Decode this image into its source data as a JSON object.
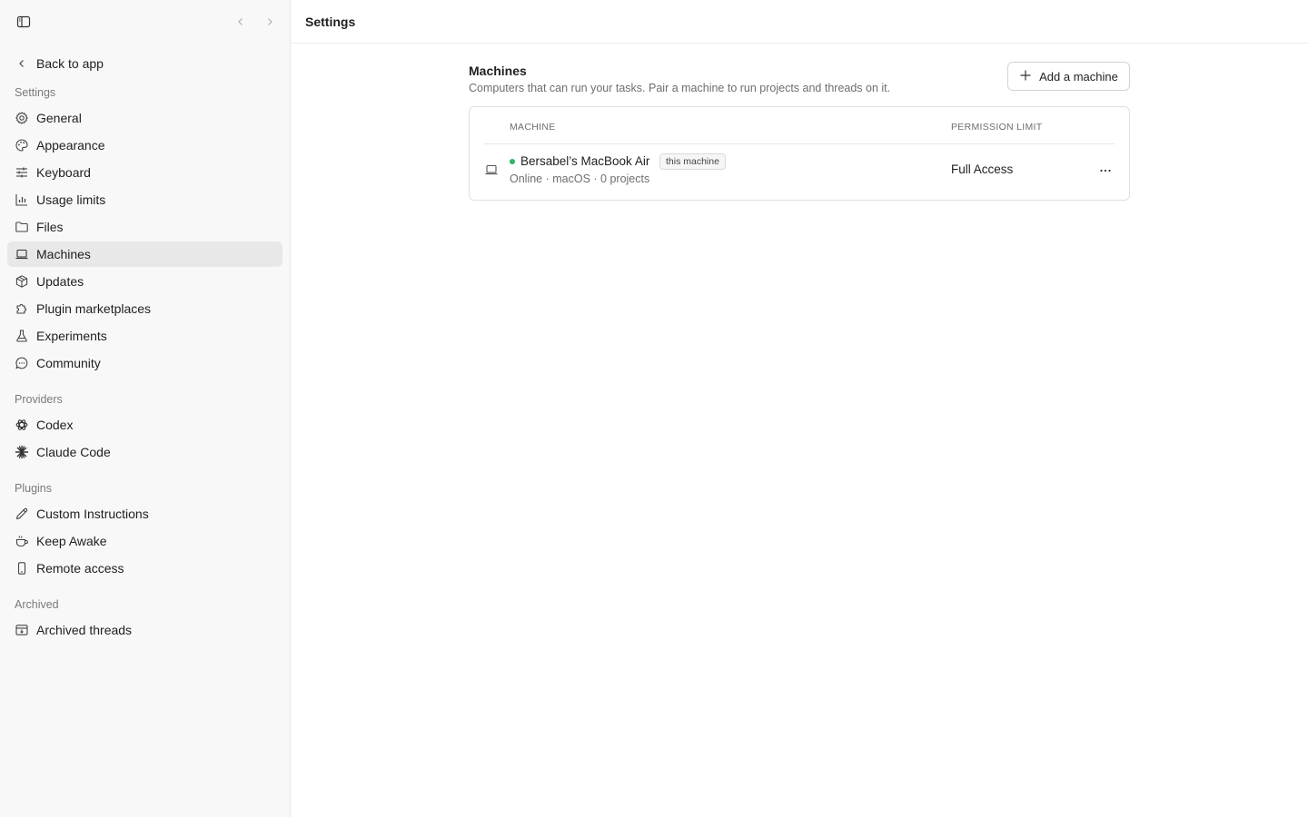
{
  "sidebar": {
    "back_label": "Back to app",
    "sections": {
      "settings": "Settings",
      "providers": "Providers",
      "plugins": "Plugins",
      "archived": "Archived"
    },
    "items": [
      {
        "label": "General",
        "icon": "gear-icon"
      },
      {
        "label": "Appearance",
        "icon": "palette-icon"
      },
      {
        "label": "Keyboard",
        "icon": "sliders-icon"
      },
      {
        "label": "Usage limits",
        "icon": "bar-chart-icon"
      },
      {
        "label": "Files",
        "icon": "folder-icon"
      },
      {
        "label": "Machines",
        "icon": "laptop-icon",
        "active": true
      },
      {
        "label": "Updates",
        "icon": "package-icon"
      },
      {
        "label": "Plugin marketplaces",
        "icon": "puzzle-icon"
      },
      {
        "label": "Experiments",
        "icon": "flask-icon"
      },
      {
        "label": "Community",
        "icon": "chat-bubble-icon"
      }
    ],
    "providers": [
      {
        "label": "Codex",
        "icon": "openai-icon"
      },
      {
        "label": "Claude Code",
        "icon": "claude-icon"
      }
    ],
    "plugins": [
      {
        "label": "Custom Instructions",
        "icon": "pencil-icon"
      },
      {
        "label": "Keep Awake",
        "icon": "coffee-icon"
      },
      {
        "label": "Remote access",
        "icon": "phone-icon"
      }
    ],
    "archived": [
      {
        "label": "Archived threads",
        "icon": "archive-icon"
      }
    ]
  },
  "header": {
    "title": "Settings"
  },
  "machines": {
    "title": "Machines",
    "description": "Computers that can run your tasks. Pair a machine to run projects and threads on it.",
    "add_button": "Add a machine",
    "columns": {
      "machine": "MACHINE",
      "permission": "PERMISSION LIMIT"
    },
    "rows": [
      {
        "name": "Bersabel’s MacBook Air",
        "badge": "this machine",
        "meta": "Online · macOS · 0 projects",
        "status": "online",
        "permission": "Full Access"
      }
    ]
  },
  "colors": {
    "online": "#2db36a",
    "active_bg": "#e8e8e8"
  }
}
